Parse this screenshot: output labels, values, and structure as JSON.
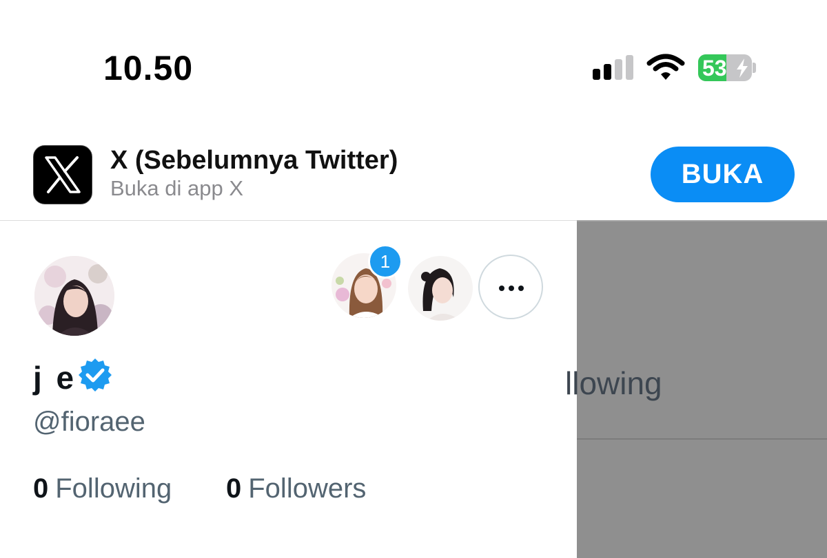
{
  "status_bar": {
    "time": "10.50",
    "battery_percent": "53",
    "battery_level": 0.53,
    "signal_bars_active": 2,
    "signal_bars_total": 4
  },
  "app_banner": {
    "app_name": "X (Sebelumnya Twitter)",
    "subtitle": "Buka di app X",
    "open_button": "BUKA",
    "icon": "x-logo-icon"
  },
  "profile": {
    "display_name": "j e",
    "handle": "@fioraee",
    "verified": true,
    "following_count": "0",
    "following_label": "Following",
    "followers_count": "0",
    "followers_label": "Followers",
    "accounts_badge": "1"
  },
  "background_panel": {
    "partial_label": "llowing"
  },
  "colors": {
    "accent": "#1d9bf0",
    "open_button": "#0a8df5",
    "battery_green": "#34c759",
    "secondary_text": "#536471",
    "overlay": "#8f8f8f"
  }
}
